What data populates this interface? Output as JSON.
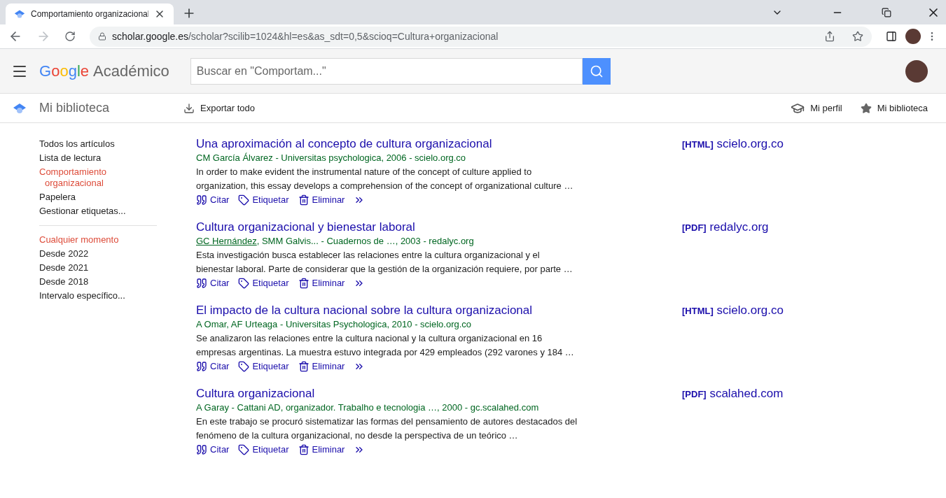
{
  "browser": {
    "tab_title": "Comportamiento organizacional",
    "url_host": "scholar.google.es",
    "url_path": "/scholar?scilib=1024&hl=es&as_sdt=0,5&scioq=Cultura+organizacional"
  },
  "header": {
    "logo_google": "Google",
    "logo_product": "Académico",
    "search": {
      "placeholder": "Buscar en \"Comportam...\""
    }
  },
  "subheader": {
    "title": "Mi biblioteca",
    "export": "Exportar todo",
    "links": [
      {
        "kind": "profile",
        "label": "Mi perfil"
      },
      {
        "kind": "library",
        "label": "Mi biblioteca"
      }
    ]
  },
  "sidebar": {
    "items": [
      {
        "label": "Todos los artículos",
        "selected": false
      },
      {
        "label": "Lista de lectura",
        "selected": false
      },
      {
        "label": "Comportamiento organizacional",
        "selected": true
      },
      {
        "label": "Papelera",
        "selected": false
      },
      {
        "label": "Gestionar etiquetas...",
        "selected": false
      }
    ],
    "time_filters": [
      {
        "label": "Cualquier momento",
        "selected": true
      },
      {
        "label": "Desde 2022",
        "selected": false
      },
      {
        "label": "Desde 2021",
        "selected": false
      },
      {
        "label": "Desde 2018",
        "selected": false
      },
      {
        "label": "Intervalo específico...",
        "selected": false
      }
    ]
  },
  "results": [
    {
      "title": "Una aproximación al concepto de cultura organizacional",
      "source": [
        {
          "text": "CM García Álvarez - Universitas psychologica, 2006 - scielo.org.co",
          "linked": false
        }
      ],
      "snippet": "In order to make evident the instrumental nature of the concept of culture applied to organization, this essay develops a comprehension of the concept of organizational culture …",
      "actions": [
        {
          "kind": "cite",
          "label": "Citar"
        },
        {
          "kind": "tag",
          "label": "Etiquetar"
        },
        {
          "kind": "delete",
          "label": "Eliminar"
        },
        {
          "kind": "more"
        }
      ],
      "file_type": "[HTML]",
      "file_host": "scielo.org.co"
    },
    {
      "title": "Cultura organizacional y bienestar laboral",
      "source": [
        {
          "text": "GC Hernández",
          "linked": true
        },
        {
          "text": ", SMM Galvis... - Cuadernos de …, 2003 - redalyc.org",
          "linked": false
        }
      ],
      "snippet": "Esta investigación busca establecer las relaciones entre la cultura organizacional y el bienestar laboral. Parte de considerar que la gestión de la organización requiere, por parte …",
      "actions": [
        {
          "kind": "cite",
          "label": "Citar"
        },
        {
          "kind": "tag",
          "label": "Etiquetar"
        },
        {
          "kind": "delete",
          "label": "Eliminar"
        },
        {
          "kind": "more"
        }
      ],
      "file_type": "[PDF]",
      "file_host": "redalyc.org"
    },
    {
      "title": "El impacto de la cultura nacional sobre la cultura organizacional",
      "source": [
        {
          "text": "A Omar, AF Urteaga - Universitas Psychologica, 2010 - scielo.org.co",
          "linked": false
        }
      ],
      "snippet": "Se analizaron las relaciones entre la cultura nacional y la cultura organizacional en 16 empresas argentinas. La muestra estuvo integrada por 429 empleados (292 varones y 184 …",
      "actions": [
        {
          "kind": "cite",
          "label": "Citar"
        },
        {
          "kind": "tag",
          "label": "Etiquetar"
        },
        {
          "kind": "delete",
          "label": "Eliminar"
        },
        {
          "kind": "more"
        }
      ],
      "file_type": "[HTML]",
      "file_host": "scielo.org.co"
    },
    {
      "title": "Cultura organizacional",
      "source": [
        {
          "text": "A Garay - Cattani AD, organizador. Trabalho e tecnologia …, 2000 - gc.scalahed.com",
          "linked": false
        }
      ],
      "snippet": "En este trabajo se procuró sistematizar las formas del pensamiento de autores destacados del fenómeno de la cultura organizacional, no desde la perspectiva de un teórico …",
      "actions": [
        {
          "kind": "cite",
          "label": "Citar"
        },
        {
          "kind": "tag",
          "label": "Etiquetar"
        },
        {
          "kind": "delete",
          "label": "Eliminar"
        },
        {
          "kind": "more"
        }
      ],
      "file_type": "[PDF]",
      "file_host": "scalahed.com"
    }
  ]
}
